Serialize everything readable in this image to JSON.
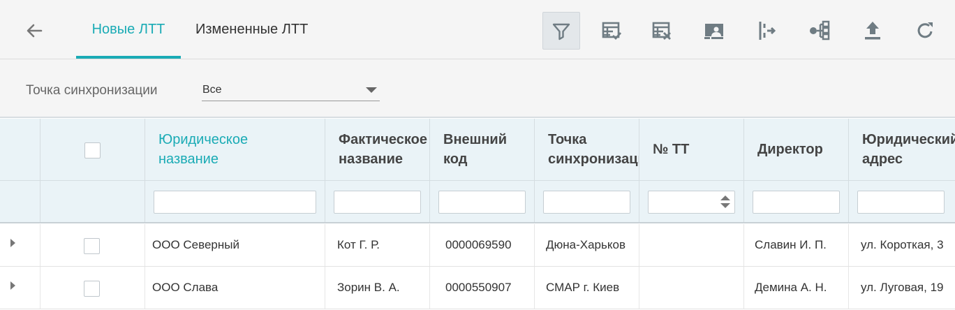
{
  "toolbar": {
    "back_icon": "arrow-left-icon",
    "tabs": [
      {
        "label": "Новые ЛТТ",
        "active": true
      },
      {
        "label": "Измененные ЛТТ",
        "active": false
      }
    ],
    "actions": [
      {
        "icon": "filter-icon",
        "active": true
      },
      {
        "icon": "table-check-icon",
        "active": false
      },
      {
        "icon": "table-remove-icon",
        "active": false
      },
      {
        "icon": "person-card-icon",
        "active": false
      },
      {
        "icon": "split-arrow-icon",
        "active": false
      },
      {
        "icon": "hierarchy-icon",
        "active": false
      },
      {
        "icon": "upload-icon",
        "active": false
      },
      {
        "icon": "refresh-icon",
        "active": false
      }
    ],
    "accent_color": "#1aabb5"
  },
  "filter": {
    "label": "Точка синхронизации",
    "selected": "Все"
  },
  "grid": {
    "columns": [
      {
        "label": "Юридическое\nназвание",
        "sorted": true
      },
      {
        "label": "Фактическое\nназвание"
      },
      {
        "label": "Внешний\nкод"
      },
      {
        "label": "Точка\nсинхронизации"
      },
      {
        "label": "№ ТТ"
      },
      {
        "label": "Директор"
      },
      {
        "label": "Юридический\nадрес"
      }
    ],
    "rows": [
      {
        "legal_name": "ООО Северный",
        "actual_name": "Кот Г. Р.",
        "ext_code": "0000069590",
        "sync_point": "Дюна-Харьков",
        "tt_no": "",
        "director": "Славин И. П.",
        "legal_address": "ул. Короткая, 3"
      },
      {
        "legal_name": "ООО Слава",
        "actual_name": "Зорин В. А.",
        "ext_code": "0000550907",
        "sync_point": "СМАР г. Киев",
        "tt_no": "",
        "director": "Демина А. Н.",
        "legal_address": "ул. Луговая, 19"
      }
    ]
  }
}
